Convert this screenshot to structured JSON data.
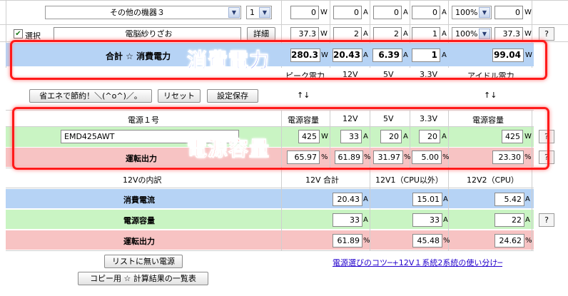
{
  "colors": {
    "blue_row": "#b6d3f5",
    "green_row": "#c9f4c3",
    "pink_row": "#f7c3c3",
    "overlay_text": "#1a40ff",
    "highlight": "#ff1a1a",
    "link": "#2200cc"
  },
  "row_device": {
    "device": "その他の機器３",
    "qty": "1",
    "watt": "0",
    "a12": "0",
    "a5": "0",
    "a33": "0",
    "pct": "100%",
    "watt2": "0",
    "unit_w": "W",
    "unit_a": "A"
  },
  "row_select": {
    "checkbox_label": "選択",
    "name": "電脳紗りざお",
    "detail": "詳細",
    "watt": "37.3",
    "a12": "2",
    "a5": "2",
    "a33": "1",
    "pct": "100%",
    "watt2": "37.3",
    "help": "?"
  },
  "total_row": {
    "label": "合計 ☆ 消費電力",
    "watt": "280.3",
    "a12": "20.43",
    "a5": "6.39",
    "a33": "1",
    "idle": "99.04"
  },
  "total_headers": {
    "peak": "ピーク電力",
    "h12": "12V",
    "h5": "5V",
    "h33": "3.3V",
    "idle": "アイドル電力"
  },
  "buttons": {
    "eco": "省エネで節約！＼(^o^)／。",
    "reset": "リセット",
    "save": "設定保存",
    "arrows": "↑↓"
  },
  "psu_header": {
    "title": "電源１号",
    "capacity": "電源容量",
    "h12": "12V",
    "h5": "5V",
    "h33": "3.3V",
    "capacity2": "電源容量"
  },
  "psu_row": {
    "name": "EMD425AWT",
    "watt": "425",
    "a12": "33",
    "a5": "20",
    "a33": "20",
    "watt2": "425",
    "help": "?"
  },
  "load_row": {
    "label": "運転出力",
    "p1": "65.97",
    "p12": "61.89",
    "p5": "31.97",
    "p33": "5.00",
    "p2": "23.30",
    "unit": "%",
    "help": "?"
  },
  "v12_header": {
    "title": "12Vの内訳",
    "total": "12V 合計",
    "v1": "12V1（CPU以外）",
    "v2": "12V2（CPU）"
  },
  "v12_rows": [
    {
      "label": "消費電流",
      "total": "20.43",
      "v1": "15.01",
      "v2": "5.42",
      "unit": "A"
    },
    {
      "label": "電源容量",
      "total": "33",
      "v1": "33",
      "v2": "22",
      "unit": "A",
      "help": "?"
    },
    {
      "label": "運転出力",
      "total": "61.89",
      "v1": "45.48",
      "v2": "24.62",
      "unit": "%"
    }
  ],
  "bottom": {
    "unlisted": "リストに無い電源",
    "link": "電源選びのコツ─+12V１系統2系統の使い分け─",
    "copy": "コピー用 ☆ 計算結果の一覧表"
  },
  "overlays": {
    "power": "消費電力",
    "capacity": "電源容量"
  }
}
